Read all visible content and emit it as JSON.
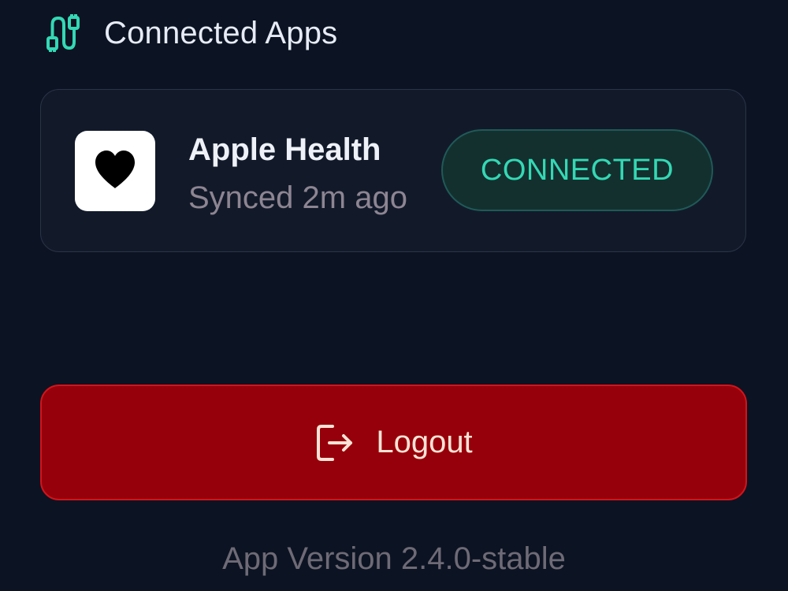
{
  "section": {
    "title": "Connected Apps",
    "icon": "plug-cable-icon",
    "accent_color": "#34d8b4"
  },
  "connected_app": {
    "name": "Apple Health",
    "sync_status": "Synced 2m ago",
    "status": "CONNECTED",
    "icon": "heart-icon",
    "status_color": "#34d8b4"
  },
  "logout": {
    "label": "Logout",
    "icon": "logout-icon",
    "background_color": "#96000a"
  },
  "footer": {
    "version": "App Version 2.4.0-stable"
  }
}
